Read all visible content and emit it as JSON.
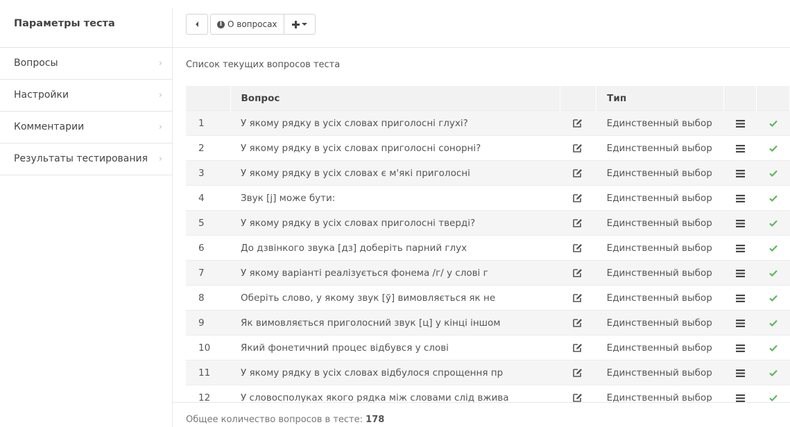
{
  "sidebar": {
    "title": "Параметры теста",
    "items": [
      {
        "label": "Вопросы"
      },
      {
        "label": "Настройки"
      },
      {
        "label": "Комментарии"
      },
      {
        "label": "Результаты тестирования"
      }
    ]
  },
  "toolbar": {
    "about_label": "О вопросах"
  },
  "list": {
    "caption": "Список текущих вопросов теста",
    "headers": {
      "question": "Вопрос",
      "type": "Тип"
    },
    "rows": [
      {
        "num": "1",
        "question": "У якому рядку в усіх словах приголосні глухі?",
        "type": "Единственный выбор"
      },
      {
        "num": "2",
        "question": "У якому рядку в усіх словах приголосні сонорні?",
        "type": "Единственный выбор"
      },
      {
        "num": "3",
        "question": "У якому рядку в усіх словах є м'які приголосні",
        "type": "Единственный выбор"
      },
      {
        "num": "4",
        "question": "Звук [j] може бути:",
        "type": "Единственный выбор"
      },
      {
        "num": "5",
        "question": "У якому рядку в усіх словах приголосні тверді?",
        "type": "Единственный выбор"
      },
      {
        "num": "6",
        "question": "До дзвінкого звука [дз]  доберіть парний глух",
        "type": "Единственный выбор"
      },
      {
        "num": "7",
        "question": "У якому варіанті реалізується фонема /г/ у слові г",
        "type": "Единственный выбор"
      },
      {
        "num": "8",
        "question": "Оберіть слово, у якому звук [ў] вимовляється як не",
        "type": "Единственный выбор"
      },
      {
        "num": "9",
        "question": "Як вимовляється приголосний звук [ц] у кінці іншом",
        "type": "Единственный выбор"
      },
      {
        "num": "10",
        "question": "Який  фонетичний процес відбувся у слові",
        "type": "Единственный выбор"
      },
      {
        "num": "11",
        "question": "У якому рядку в усіх словах відбулося спрощення пр",
        "type": "Единственный выбор"
      },
      {
        "num": "12",
        "question": "У словосполуках якого рядка між словами слід вжива",
        "type": "Единственный выбор"
      }
    ]
  },
  "footer": {
    "label": "Общее количество вопросов в тесте:",
    "count": "178"
  },
  "icons": {
    "back": "chevron-left-icon",
    "info": "info-circle-icon",
    "add": "plus-icon",
    "dropdown": "caret-down-icon",
    "edit": "edit-icon",
    "menu": "menu-icon",
    "check": "check-icon",
    "chevron": "chevron-right-icon"
  },
  "colors": {
    "check": "#5cb85c",
    "row_stripe": "#f5f5f5",
    "header_bg": "#f2f2f2"
  }
}
